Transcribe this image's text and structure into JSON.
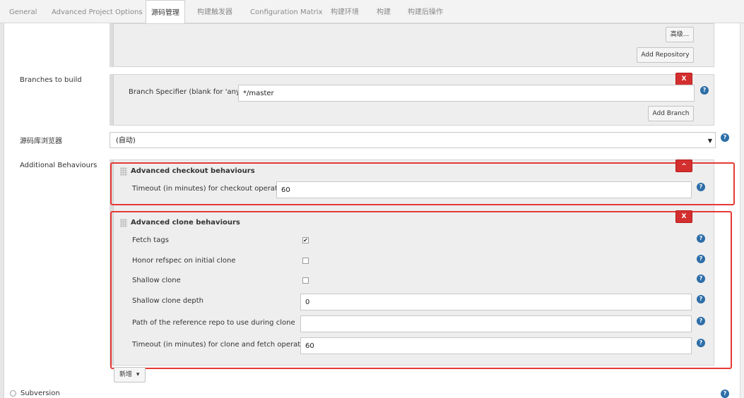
{
  "tabs": [
    {
      "label": "General"
    },
    {
      "label": "Advanced Project Options"
    },
    {
      "label": "源码管理"
    },
    {
      "label": "构建触发器"
    },
    {
      "label": "Configuration Matrix"
    },
    {
      "label": "构建环境"
    },
    {
      "label": "构建"
    },
    {
      "label": "构建后操作"
    }
  ],
  "repo": {
    "advanced_label": "高级...",
    "add_repository_label": "Add Repository"
  },
  "branches": {
    "section_label": "Branches to build",
    "remove_label": "X",
    "specifier_label": "Branch Specifier (blank for 'any')",
    "specifier_value": "*/master",
    "add_branch_label": "Add Branch"
  },
  "browser": {
    "label": "源码库浏览器",
    "selected": "(自动)",
    "arrow": "▼"
  },
  "behaviours": {
    "section_label": "Additional Behaviours",
    "checkout": {
      "title": "Advanced checkout behaviours",
      "collapse_label": "^",
      "timeout_label": "Timeout (in minutes) for checkout operation",
      "timeout_value": "60"
    },
    "clone": {
      "title": "Advanced clone behaviours",
      "remove_label": "X",
      "fetch_tags_label": "Fetch tags",
      "fetch_tags_checked": true,
      "honor_refspec_label": "Honor refspec on initial clone",
      "honor_refspec_checked": false,
      "shallow_clone_label": "Shallow clone",
      "shallow_clone_checked": false,
      "shallow_depth_label": "Shallow clone depth",
      "shallow_depth_value": "0",
      "reference_repo_label": "Path of the reference repo to use during clone",
      "reference_repo_value": "",
      "timeout_label": "Timeout (in minutes) for clone and fetch operations",
      "timeout_value": "60"
    },
    "add_label": "新增",
    "add_arrow": "▾"
  },
  "subversion": {
    "label": "Subversion"
  },
  "icons": {
    "help": "help-icon",
    "check": "✔",
    "help_glyph": "?"
  },
  "colors": {
    "highlight": "#e53935",
    "remove": "#d32f2f",
    "help": "#2c6ea8"
  }
}
